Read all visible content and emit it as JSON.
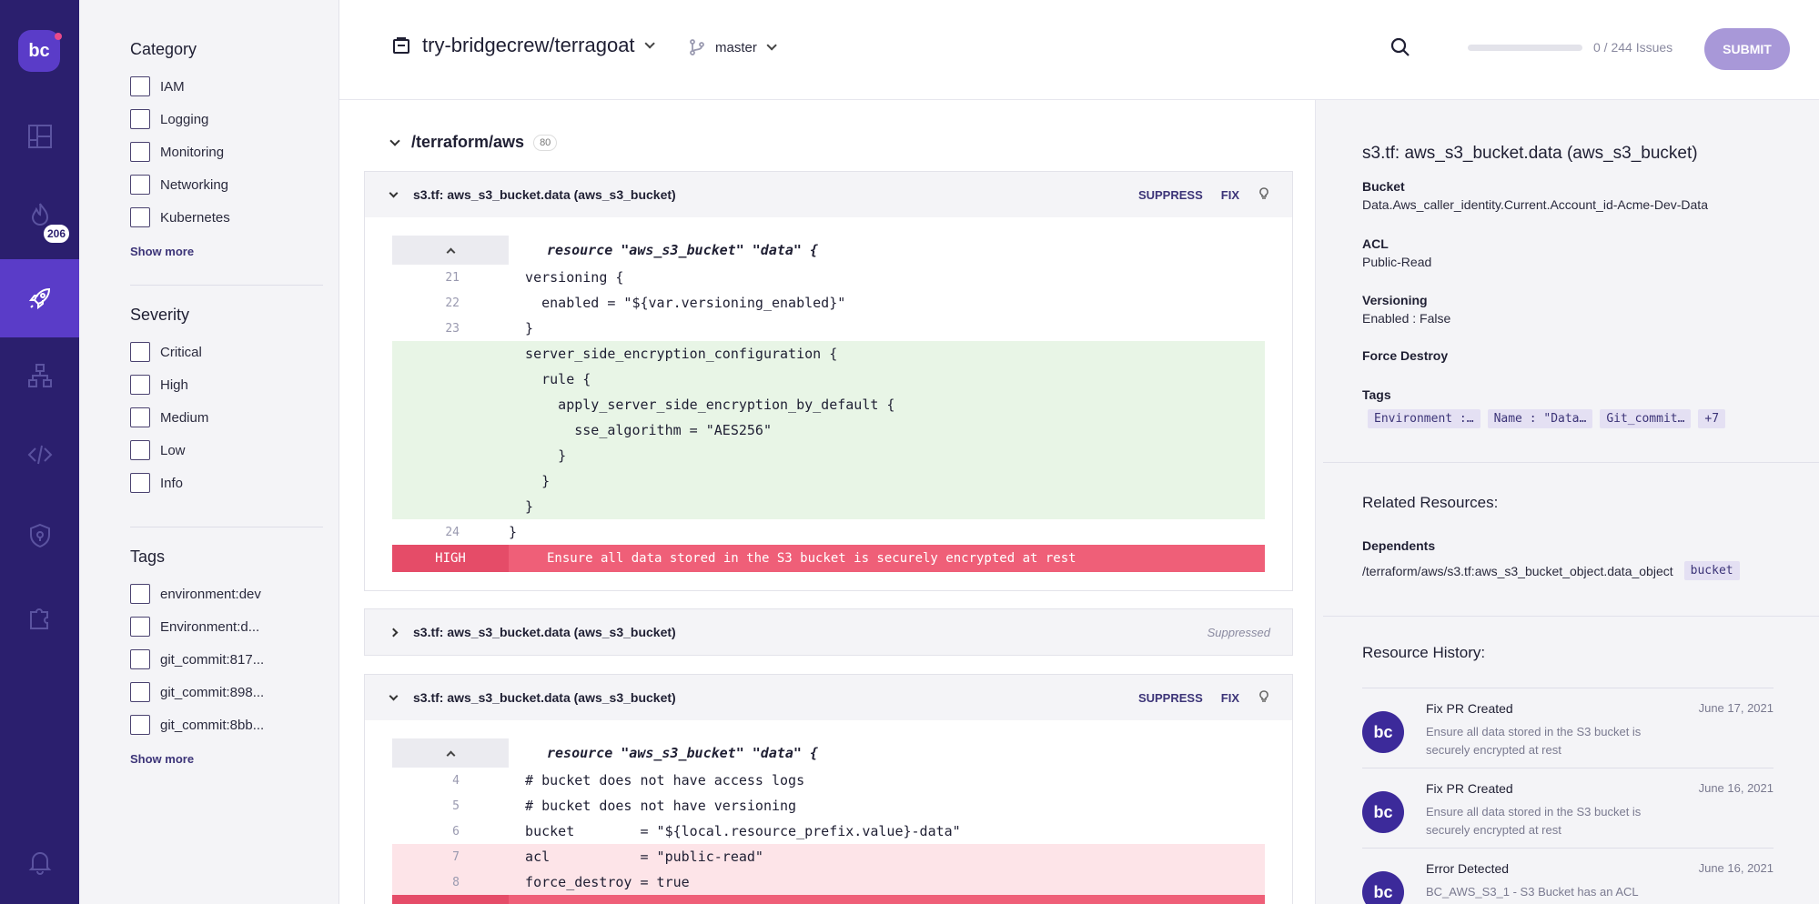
{
  "rail": {
    "logo": "bc",
    "badge": "206",
    "icons": [
      "dashboard-icon",
      "flame-icon",
      "rocket-icon",
      "hierarchy-icon",
      "code-icon",
      "shield-icon",
      "puzzle-icon",
      "bell-icon"
    ]
  },
  "filters": {
    "category": {
      "title": "Category",
      "items": [
        "IAM",
        "Logging",
        "Monitoring",
        "Networking",
        "Kubernetes"
      ],
      "more": "Show more"
    },
    "severity": {
      "title": "Severity",
      "items": [
        "Critical",
        "High",
        "Medium",
        "Low",
        "Info"
      ]
    },
    "tags": {
      "title": "Tags",
      "items": [
        "environment:dev",
        "Environment:d...",
        "git_commit:817...",
        "git_commit:898...",
        "git_commit:8bb..."
      ],
      "more": "Show more"
    }
  },
  "header": {
    "repo": "try-bridgecrew/terragoat",
    "branch": "master",
    "issues": "0 / 244 Issues",
    "progress": 0,
    "submit": "SUBMIT"
  },
  "main": {
    "path": "/terraform/aws",
    "path_count": "80",
    "cards": [
      {
        "title": "s3.tf: aws_s3_bucket.data (aws_s3_bucket)",
        "suppress": "SUPPRESS",
        "fix": "FIX",
        "resource_line": "resource \"aws_s3_bucket\" \"data\" {",
        "lines": [
          {
            "n": "21",
            "t": "  versioning {"
          },
          {
            "n": "22",
            "t": "    enabled = \"${var.versioning_enabled}\""
          },
          {
            "n": "23",
            "t": "  }"
          },
          {
            "n": "",
            "t": "  server_side_encryption_configuration {"
          },
          {
            "n": "",
            "t": "    rule {"
          },
          {
            "n": "",
            "t": "      apply_server_side_encryption_by_default {"
          },
          {
            "n": "",
            "t": "        sse_algorithm = \"AES256\""
          },
          {
            "n": "",
            "t": "      }"
          },
          {
            "n": "",
            "t": "    }"
          },
          {
            "n": "",
            "t": "  }"
          },
          {
            "n": "24",
            "t": "}"
          }
        ],
        "severity": "HIGH",
        "message": "Ensure all data stored in the S3 bucket is securely encrypted at rest"
      },
      {
        "title": "s3.tf: aws_s3_bucket.data (aws_s3_bucket)",
        "status": "Suppressed"
      },
      {
        "title": "s3.tf: aws_s3_bucket.data (aws_s3_bucket)",
        "suppress": "SUPPRESS",
        "fix": "FIX",
        "resource_line": "resource \"aws_s3_bucket\" \"data\" {",
        "lines": [
          {
            "n": "4",
            "t": "  # bucket does not have access logs"
          },
          {
            "n": "5",
            "t": "  # bucket does not have versioning"
          },
          {
            "n": "6",
            "t": "  bucket        = \"${local.resource_prefix.value}-data\""
          },
          {
            "n": "7",
            "t": "  acl           = \"public-read\""
          },
          {
            "n": "8",
            "t": "  force_destroy = true"
          }
        ]
      }
    ]
  },
  "detail": {
    "title": "s3.tf: aws_s3_bucket.data (aws_s3_bucket)",
    "props": [
      {
        "k": "Bucket",
        "v": "Data.Aws_caller_identity.Current.Account_id-Acme-Dev-Data"
      },
      {
        "k": "ACL",
        "v": "Public-Read"
      },
      {
        "k": "Versioning",
        "v": "Enabled : False"
      },
      {
        "k": "Force Destroy",
        "v": ""
      },
      {
        "k": "Tags",
        "v": ""
      }
    ],
    "tags": [
      "Environment :…",
      "Name : \"Data…",
      "Git_commit…",
      "+7"
    ],
    "related_title": "Related Resources:",
    "dependents_label": "Dependents",
    "dependent_path": "/terraform/aws/s3.tf:aws_s3_bucket_object.data_object",
    "dependent_tag": "bucket",
    "history_title": "Resource History:",
    "history": [
      {
        "title": "Fix PR Created",
        "desc": "Ensure all data stored in the S3 bucket is securely encrypted at rest",
        "date": "June 17, 2021"
      },
      {
        "title": "Fix PR Created",
        "desc": "Ensure all data stored in the S3 bucket is securely encrypted at rest",
        "date": "June 16, 2021"
      },
      {
        "title": "Error Detected",
        "desc": "BC_AWS_S3_1 - S3 Bucket has an ACL",
        "date": "June 16, 2021"
      }
    ]
  },
  "colors": {
    "rail": "#2b1f6e",
    "accent": "#5a3cc8",
    "high": "#ef5f78",
    "added": "#e8f5e6",
    "removed": "#fde4e8"
  }
}
